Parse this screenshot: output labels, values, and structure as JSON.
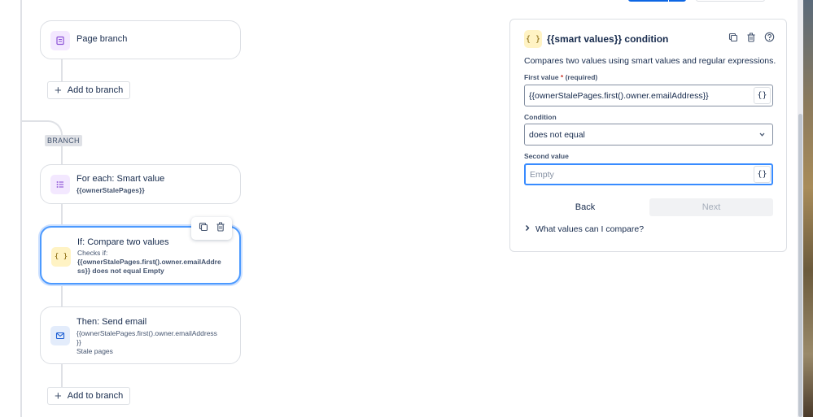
{
  "flow": {
    "page_branch": {
      "title": "Page branch"
    },
    "add_to_branch_label": "Add to branch",
    "branch_tag": "BRANCH",
    "for_each": {
      "title": "For each: Smart value",
      "sub": "{{ownerStalePages}}"
    },
    "if_compare": {
      "title": "If: Compare two values",
      "checks": "Checks if:",
      "expr_line1": "{{ownerStalePages.first().owner.emailAddre",
      "expr_line2": "ss}} does not equal Empty"
    },
    "send_email": {
      "title": "Then: Send email",
      "line1": "{{ownerStalePages.first().owner.emailAddress",
      "line2": "}}",
      "line3": "Stale pages"
    }
  },
  "panel": {
    "icon_text": "{ }",
    "title": "{{smart values}} condition",
    "description": "Compares two values using smart values and regular expressions.",
    "first_value_label": "First value",
    "required_marker": "*",
    "required_text": "(required)",
    "first_value": "{{ownerStalePages.first().owner.emailAddress}}",
    "condition_label": "Condition",
    "condition_value": "does not equal",
    "second_value_label": "Second value",
    "second_value_placeholder": "Empty",
    "brace_button": "{}",
    "back_label": "Back",
    "next_label": "Next",
    "expander_label": "What values can I compare?"
  },
  "icons": [
    "page-icon",
    "list-icon",
    "braces-icon",
    "mail-icon",
    "plus-icon",
    "copy-icon",
    "trash-icon",
    "help-icon",
    "chevron-down-icon",
    "chevron-right-icon"
  ],
  "colors": {
    "accent": "#0c66e4",
    "selected_border": "#4c9aff",
    "purple": "#f3e8ff",
    "yellow": "#fff3c4"
  }
}
